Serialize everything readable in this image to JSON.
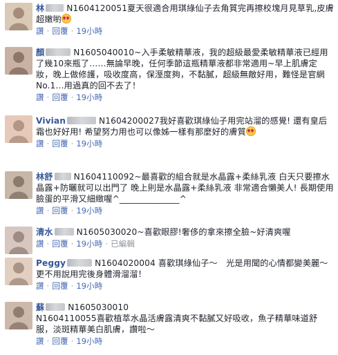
{
  "meta_labels": {
    "like": "讚",
    "reply": "回覆",
    "separator": "·"
  },
  "comments": [
    {
      "author": "林",
      "order_id": "N1604120051",
      "text": "夏天很適合用琪綠仙子去角質完再擦校塊月見草乳,皮膚超嫩喲",
      "has_emoji": true,
      "time": "19小時",
      "edited": ""
    },
    {
      "author": "顏",
      "order_id": "N1605040010",
      "text": "~入手柔敏精華液，我的超級最愛柔敏精華液已經用了幾10來瓶了……無論早晚，任何季節這瓶精華液都非常適用~早上肌膚定妝，晚上做修護，吸收度高，保溼度夠，不黏膩，超級無敵好用，難怪是官網No.1…用過真的回不去了！",
      "has_emoji": false,
      "time": "19小時",
      "edited": ""
    },
    {
      "author": "Vivian",
      "order_id": "N1604200027",
      "text": "我好喜歡琪綠仙子用完站溜的感覺! 還有皇后霜也好好用! 希望努力用也可以像姊一樣有那麼好的膚質",
      "has_emoji": true,
      "time": "19小時",
      "edited": ""
    },
    {
      "author": "林舒",
      "order_id": "N1604110092",
      "text": "~最喜歡的組合就是水晶露+柔絲乳液 白天只要擦水晶露+防曬就可以出門了 晚上則是水晶露+柔絲乳液 非常適合懶美人! 長期使用臉蛋的平滑又細緻喔^______________^",
      "has_emoji": false,
      "time": "19小時",
      "edited": ""
    },
    {
      "author": "清水",
      "order_id": "N1605030020",
      "text": "~喜歡眼膠!奢侈的拿來擦全臉~好清爽喔",
      "has_emoji": false,
      "time": "19小時",
      "edited": "已編輯"
    },
    {
      "author": "Peggy",
      "order_id": "N1604020004",
      "text": " 喜歡琪綠仙子～　光是用聞的心情都變美麗～　更不用說用完後身體滑溜溜！",
      "has_emoji": false,
      "time": "19小時",
      "edited": ""
    },
    {
      "author": "蘇",
      "order_id": "N1605030010",
      "text": "N1604110055喜歡植萃水晶活膚露清爽不黏膩又好吸收，魚子精華味道舒服，淡斑精華美白肌膚，讚啦～",
      "newline": true,
      "has_emoji": false,
      "time": "19小時",
      "edited": ""
    }
  ]
}
